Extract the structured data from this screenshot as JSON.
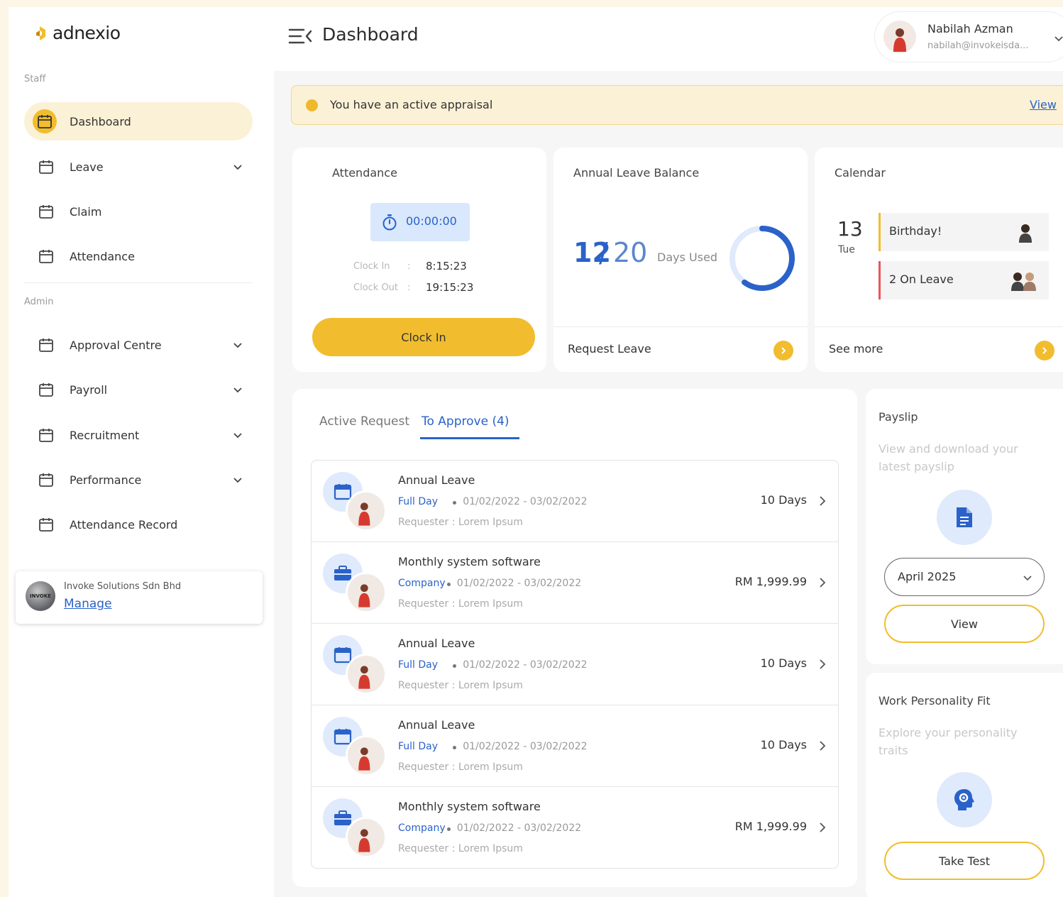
{
  "brand": {
    "name": "adnexio"
  },
  "sidebar": {
    "staff_label": "Staff",
    "admin_label": "Admin",
    "staff_items": [
      {
        "label": "Dashboard",
        "active": true,
        "has_chevron": false
      },
      {
        "label": "Leave",
        "active": false,
        "has_chevron": true
      },
      {
        "label": "Claim",
        "active": false,
        "has_chevron": false
      },
      {
        "label": "Attendance",
        "active": false,
        "has_chevron": false
      }
    ],
    "admin_items": [
      {
        "label": "Approval Centre",
        "has_chevron": true
      },
      {
        "label": "Payroll",
        "has_chevron": true
      },
      {
        "label": "Recruitment",
        "has_chevron": true
      },
      {
        "label": "Performance",
        "has_chevron": true
      },
      {
        "label": "Attendance Record",
        "has_chevron": false
      }
    ],
    "company": {
      "name": "Invoke Solutions Sdn Bhd",
      "link": "Manage",
      "logo_text": "INVOKE"
    }
  },
  "header": {
    "title": "Dashboard",
    "user": {
      "name": "Nabilah Azman",
      "email": "nabilah@invokeisda..."
    }
  },
  "alert": {
    "text": "You have an active appraisal",
    "link": "View"
  },
  "attendance": {
    "title": "Attendance",
    "timer": "00:00:00",
    "clock_in_label": "Clock In",
    "clock_in_value": "8:15:23",
    "clock_out_label": "Clock Out",
    "clock_out_value": "19:15:23",
    "button": "Clock In"
  },
  "leave_balance": {
    "title": "Annual Leave Balance",
    "used": "12",
    "total": "20",
    "label": "Days Used",
    "used_fraction": 0.6,
    "link": "Request Leave"
  },
  "calendar": {
    "title": "Calendar",
    "day": "13",
    "weekday": "Tue",
    "events": [
      {
        "text": "Birthday!",
        "accent": "#f1bd2e"
      },
      {
        "text": "2 On Leave",
        "accent": "#e8555a"
      }
    ],
    "link": "See more"
  },
  "requests": {
    "tabs": [
      {
        "label": "Active Request",
        "active": false
      },
      {
        "label": "To Approve (4)",
        "active": true
      }
    ],
    "items": [
      {
        "title": "Annual Leave",
        "type": "Full Day",
        "dates": "01/02/2022 - 03/02/2022",
        "requester": "Requester : Lorem Ipsum",
        "amount": "10 Days",
        "icon": "calendar-icon"
      },
      {
        "title": "Monthly system software",
        "type": "Company",
        "dates": "01/02/2022 - 03/02/2022",
        "requester": "Requester : Lorem Ipsum",
        "amount": "RM 1,999.99",
        "icon": "briefcase-icon"
      },
      {
        "title": "Annual Leave",
        "type": "Full Day",
        "dates": "01/02/2022 - 03/02/2022",
        "requester": "Requester : Lorem Ipsum",
        "amount": "10 Days",
        "icon": "calendar-icon"
      },
      {
        "title": "Annual Leave",
        "type": "Full Day",
        "dates": "01/02/2022 - 03/02/2022",
        "requester": "Requester : Lorem Ipsum",
        "amount": "10 Days",
        "icon": "calendar-icon"
      },
      {
        "title": "Monthly system software",
        "type": "Company",
        "dates": "01/02/2022 - 03/02/2022",
        "requester": "Requester : Lorem Ipsum",
        "amount": "RM 1,999.99",
        "icon": "briefcase-icon"
      }
    ]
  },
  "payslip": {
    "title": "Payslip",
    "desc": "View and download your latest payslip",
    "month": "April 2025",
    "button": "View"
  },
  "personality": {
    "title": "Work Personality Fit",
    "desc": "Explore your personality traits",
    "button": "Take Test"
  },
  "colors": {
    "accent": "#f1bd2e",
    "primary": "#2a62c9",
    "alert_bg": "#fbf1d6"
  }
}
